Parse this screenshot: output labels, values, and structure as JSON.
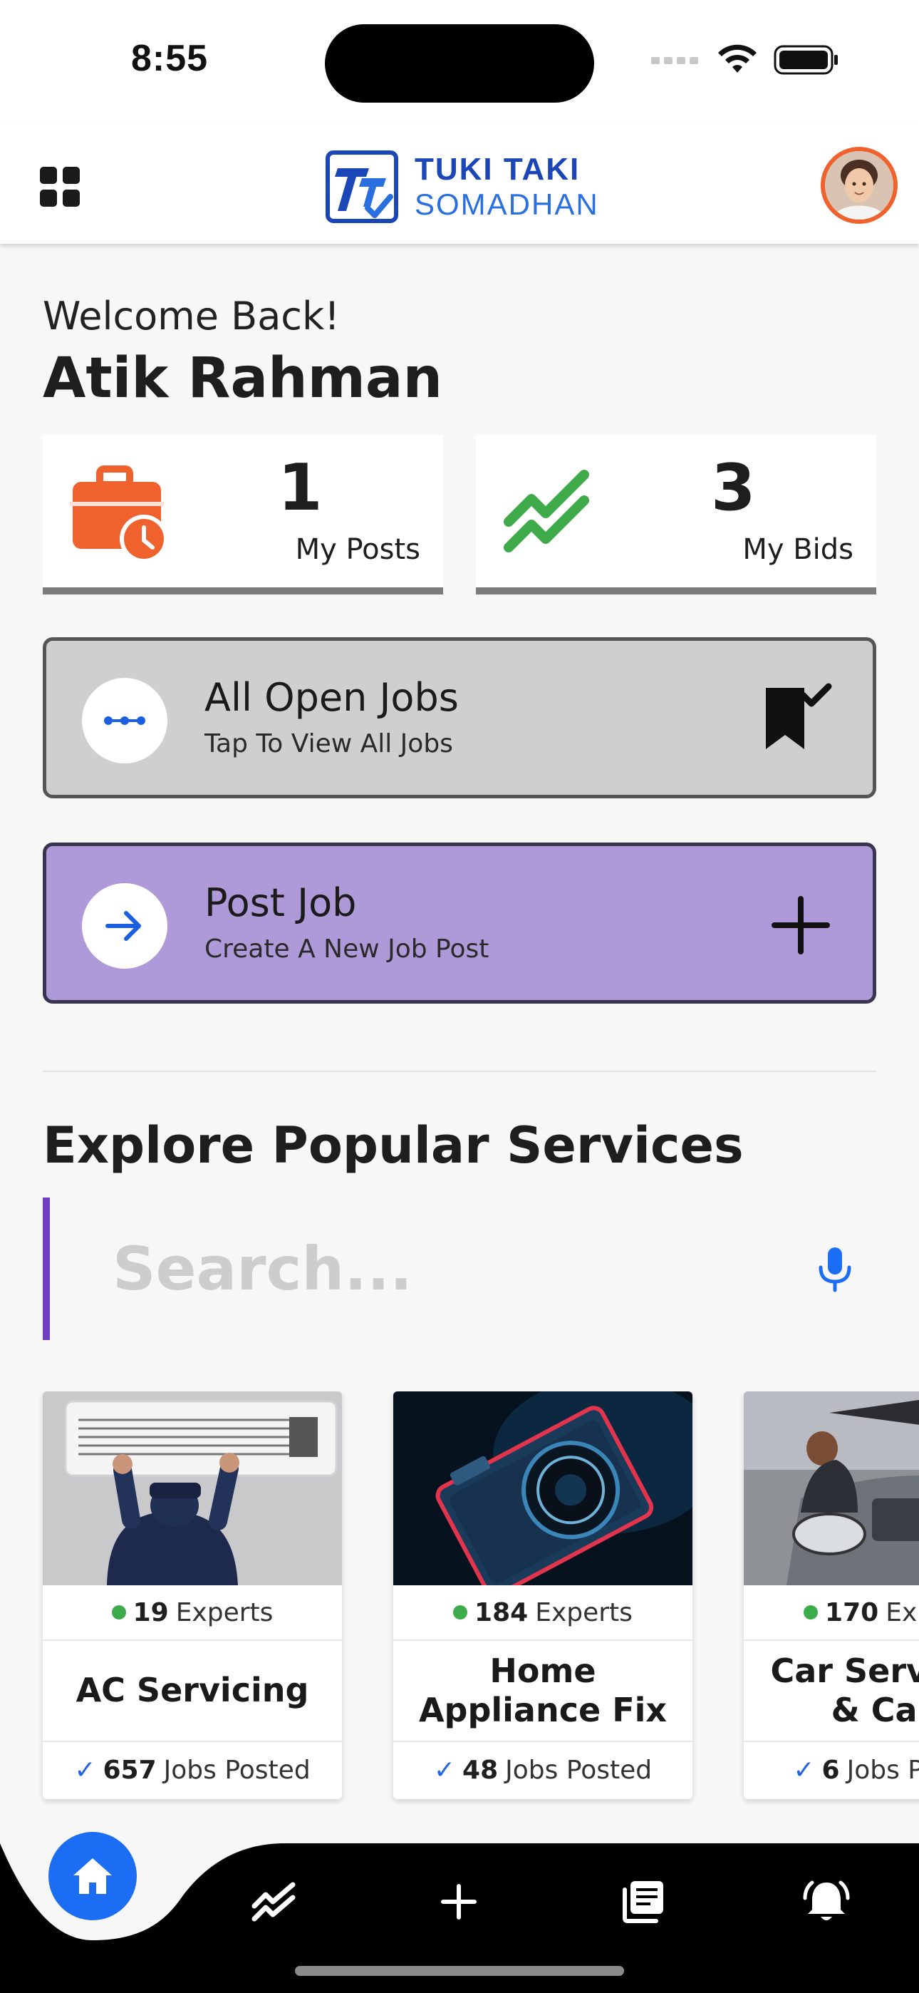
{
  "status_bar": {
    "time": "8:55"
  },
  "header": {
    "brand_line1": "TUKI TAKI",
    "brand_line2": "SOMADHAN",
    "menu_icon": "grid-menu-icon",
    "avatar": "user-avatar"
  },
  "welcome": {
    "greeting": "Welcome Back!",
    "name": "Atik Rahman"
  },
  "stats": {
    "posts": {
      "count": "1",
      "label": "My Posts",
      "icon": "briefcase-clock-icon",
      "color": "#f0622d"
    },
    "bids": {
      "count": "3",
      "label": "My Bids",
      "icon": "trending-icon",
      "color": "#3eaa4a"
    }
  },
  "actions": {
    "open_jobs": {
      "title": "All Open Jobs",
      "subtitle": "Tap To View All Jobs",
      "left_icon": "dots-icon",
      "right_icon": "bookmark-check-icon"
    },
    "post_job": {
      "title": "Post Job",
      "subtitle": "Create A New Job Post",
      "left_icon": "arrow-right-icon",
      "right_icon": "plus-icon"
    }
  },
  "section": {
    "title": "Explore Popular Services"
  },
  "search": {
    "placeholder": "Search..."
  },
  "services": [
    {
      "experts_count": "19",
      "experts_label": "Experts",
      "name": "AC Servicing",
      "jobs_count": "657",
      "jobs_label": "Jobs Posted"
    },
    {
      "experts_count": "184",
      "experts_label": "Experts",
      "name": "Home Appliance Fix",
      "jobs_count": "48",
      "jobs_label": "Jobs Posted"
    },
    {
      "experts_count": "170",
      "experts_label": "Experts",
      "name": "Car Servicing & Care",
      "jobs_count": "6",
      "jobs_label": "Jobs Posted"
    }
  ],
  "bottom_nav": {
    "items": [
      "home-icon",
      "trending-icon",
      "plus-icon",
      "news-icon",
      "bell-icon"
    ],
    "active": "home-icon",
    "active_color": "#1b6ef3"
  }
}
